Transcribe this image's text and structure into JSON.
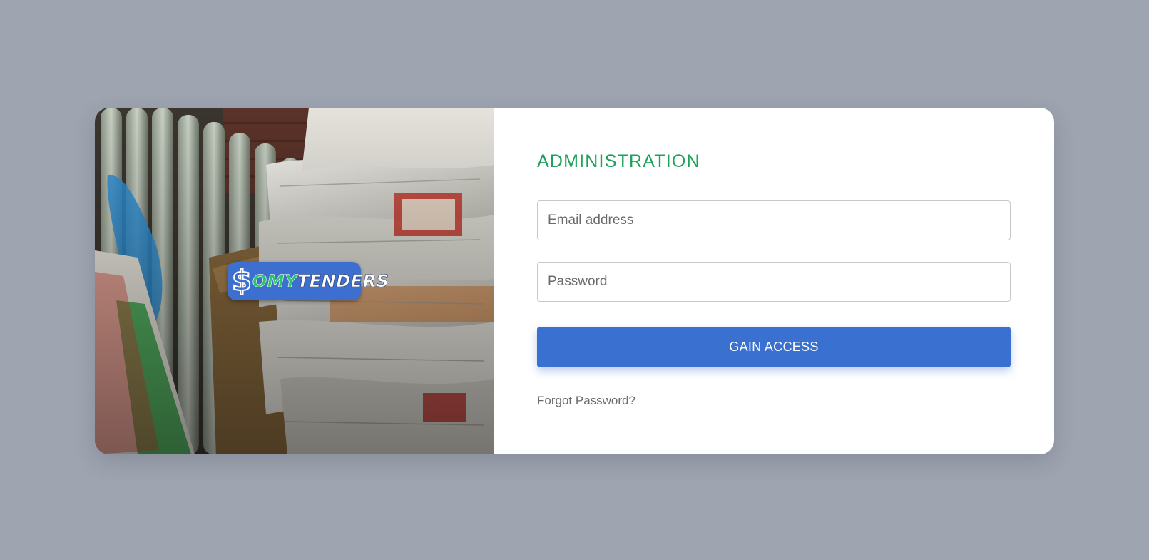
{
  "login": {
    "title": "ADMINISTRATION",
    "email_placeholder": "Email address",
    "password_placeholder": "Password",
    "submit_label": "GAIN ACCESS",
    "forgot_label": "Forgot Password?"
  },
  "brand": {
    "dollar": "$",
    "name_part_1": "OMY",
    "name_part_2": "TENDERS",
    "accent_color": "#3c6fd0",
    "green_color": "#2ec46b"
  },
  "colors": {
    "background": "#9ea4b0",
    "title": "#1fa15a",
    "button": "#3a70cf"
  }
}
